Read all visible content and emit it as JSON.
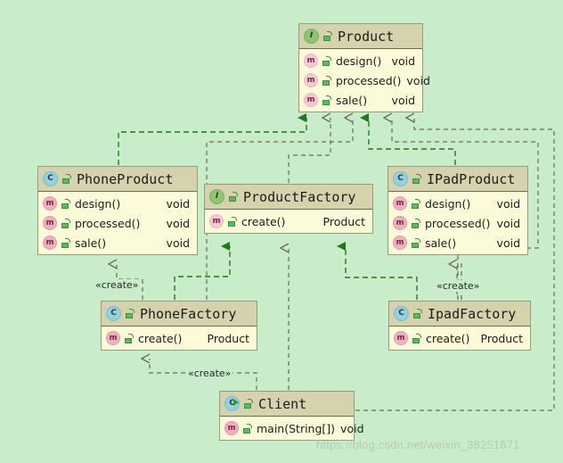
{
  "diagram": {
    "type": "uml-class-diagram",
    "background_color": "#c9ecca",
    "header_color": "#d5d2ae",
    "body_color": "#fbfbd9",
    "realization_color": "#1f7a1f",
    "dependency_color": "#6b6b58",
    "watermark": "https://blog.csdn.net/weixin_38251871"
  },
  "classes": [
    {
      "id": "product",
      "name": "Product",
      "kind": "interface",
      "icon": "interface-icon",
      "visibility_icon": "unlock-icon",
      "members": [
        {
          "icon": "method-icon",
          "name": "design()",
          "type": "void"
        },
        {
          "icon": "method-icon",
          "name": "processed()",
          "type": "void"
        },
        {
          "icon": "method-icon",
          "name": "sale()",
          "type": "void"
        }
      ]
    },
    {
      "id": "phoneproduct",
      "name": "PhoneProduct",
      "kind": "class",
      "icon": "class-icon",
      "visibility_icon": "unlock-icon",
      "members": [
        {
          "icon": "method-icon",
          "name": "design()",
          "type": "void"
        },
        {
          "icon": "method-icon",
          "name": "processed()",
          "type": "void"
        },
        {
          "icon": "method-icon",
          "name": "sale()",
          "type": "void"
        }
      ]
    },
    {
      "id": "productfactory",
      "name": "ProductFactory",
      "kind": "interface",
      "icon": "interface-icon",
      "visibility_icon": "unlock-icon",
      "members": [
        {
          "icon": "method-icon",
          "name": "create()",
          "type": "Product"
        }
      ]
    },
    {
      "id": "ipadproduct",
      "name": "IPadProduct",
      "kind": "class",
      "icon": "class-icon",
      "visibility_icon": "unlock-icon",
      "members": [
        {
          "icon": "method-icon",
          "name": "design()",
          "type": "void"
        },
        {
          "icon": "method-icon",
          "name": "processed()",
          "type": "void"
        },
        {
          "icon": "method-icon",
          "name": "sale()",
          "type": "void"
        }
      ]
    },
    {
      "id": "phonefactory",
      "name": "PhoneFactory",
      "kind": "class",
      "icon": "class-icon",
      "visibility_icon": "unlock-icon",
      "members": [
        {
          "icon": "method-icon",
          "name": "create()",
          "type": "Product"
        }
      ]
    },
    {
      "id": "ipadfactory",
      "name": "IpadFactory",
      "kind": "class",
      "icon": "class-icon",
      "visibility_icon": "unlock-icon",
      "members": [
        {
          "icon": "method-icon",
          "name": "create()",
          "type": "Product"
        }
      ]
    },
    {
      "id": "client",
      "name": "Client",
      "kind": "class-runnable",
      "icon": "class-run-icon",
      "visibility_icon": "unlock-icon",
      "members": [
        {
          "icon": "method-icon",
          "name": "main(String[])",
          "type": "void"
        }
      ]
    }
  ],
  "edge_labels": {
    "phone_create": "«create»",
    "ipad_create": "«create»",
    "client_create": "«create»"
  },
  "relationships": [
    {
      "from": "PhoneProduct",
      "to": "Product",
      "kind": "realization"
    },
    {
      "from": "IPadProduct",
      "to": "Product",
      "kind": "realization"
    },
    {
      "from": "PhoneFactory",
      "to": "ProductFactory",
      "kind": "realization"
    },
    {
      "from": "IpadFactory",
      "to": "ProductFactory",
      "kind": "realization"
    },
    {
      "from": "ProductFactory",
      "to": "Product",
      "kind": "dependency"
    },
    {
      "from": "PhoneFactory",
      "to": "Product",
      "kind": "dependency"
    },
    {
      "from": "IpadFactory",
      "to": "Product",
      "kind": "dependency"
    },
    {
      "from": "Client",
      "to": "Product",
      "kind": "dependency"
    },
    {
      "from": "PhoneFactory",
      "to": "PhoneProduct",
      "kind": "dependency",
      "label": "«create»"
    },
    {
      "from": "IpadFactory",
      "to": "IPadProduct",
      "kind": "dependency",
      "label": "«create»"
    },
    {
      "from": "Client",
      "to": "PhoneFactory",
      "kind": "dependency",
      "label": "«create»"
    },
    {
      "from": "Client",
      "to": "ProductFactory",
      "kind": "dependency"
    }
  ]
}
